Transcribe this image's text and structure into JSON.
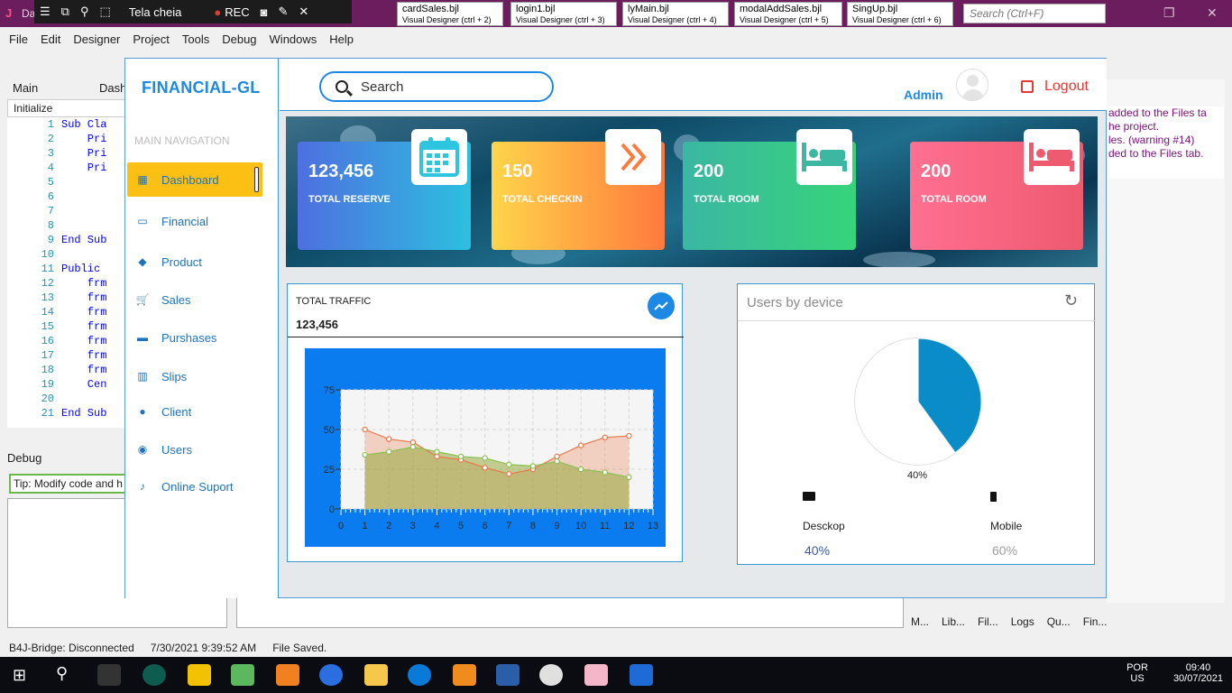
{
  "ide": {
    "recorder": {
      "label": "Tela cheia",
      "rec": "REC"
    },
    "doc_tabs": [
      {
        "name": "cardSales.bjl",
        "sub": "Visual Designer  (ctrl + 2)"
      },
      {
        "name": "login1.bjl",
        "sub": "Visual Designer  (ctrl + 3)"
      },
      {
        "name": "lyMain.bjl",
        "sub": "Visual Designer  (ctrl + 4)"
      },
      {
        "name": "modalAddSales.bjl",
        "sub": "Visual Designer  (ctrl + 5)"
      },
      {
        "name": "SingUp.bjl",
        "sub": "Visual Designer  (ctrl + 6)"
      }
    ],
    "search_placeholder": "Search (Ctrl+F)",
    "menu": [
      "File",
      "Edit",
      "Designer",
      "Project",
      "Tools",
      "Debug",
      "Windows",
      "Help"
    ],
    "tabs": [
      "Main",
      "Dash"
    ],
    "initialize": "Initialize",
    "code_lines": [
      {
        "n": "1",
        "t": "Sub Cla"
      },
      {
        "n": "2",
        "t": "    Pri"
      },
      {
        "n": "3",
        "t": "    Pri"
      },
      {
        "n": "4",
        "t": "    Pri"
      },
      {
        "n": "5",
        "t": ""
      },
      {
        "n": "6",
        "t": ""
      },
      {
        "n": "7",
        "t": ""
      },
      {
        "n": "8",
        "t": ""
      },
      {
        "n": "9",
        "t": "End Sub"
      },
      {
        "n": "10",
        "t": ""
      },
      {
        "n": "11",
        "t": "Public"
      },
      {
        "n": "12",
        "t": "    frm"
      },
      {
        "n": "13",
        "t": "    frm"
      },
      {
        "n": "14",
        "t": "    frm"
      },
      {
        "n": "15",
        "t": "    frm"
      },
      {
        "n": "16",
        "t": "    frm"
      },
      {
        "n": "17",
        "t": "    frm"
      },
      {
        "n": "18",
        "t": "    frm"
      },
      {
        "n": "19",
        "t": "    Cen"
      },
      {
        "n": "20",
        "t": ""
      },
      {
        "n": "21",
        "t": "End Sub"
      }
    ],
    "debug_label": "Debug",
    "tip": "Tip: Modify code and h",
    "right_msgs": [
      "added to the Files ta",
      "he project.",
      "les. (warning #14)",
      "ded to the Files tab."
    ],
    "right_tabs": [
      "M...",
      "Lib...",
      "Fil...",
      "Logs",
      "Qu...",
      "Fin..."
    ],
    "status": {
      "bridge": "B4J-Bridge: Disconnected",
      "time": "7/30/2021 9:39:52 AM",
      "msg": "File Saved."
    },
    "tray": {
      "lang": "POR",
      "region": "US",
      "clock": "09:40",
      "date": "30/07/2021"
    }
  },
  "app": {
    "brand": "FINANCIAL-GL",
    "nav_heading": "MAIN NAVIGATION",
    "nav": [
      {
        "label": "Dashboard",
        "icon": "grid-icon"
      },
      {
        "label": "Financial",
        "icon": "money-icon"
      },
      {
        "label": "Product",
        "icon": "cubes-icon"
      },
      {
        "label": "Sales",
        "icon": "cart-icon"
      },
      {
        "label": "Purshases",
        "icon": "truck-icon"
      },
      {
        "label": "Slips",
        "icon": "barcode-icon"
      },
      {
        "label": "Client",
        "icon": "users-icon"
      },
      {
        "label": "Users",
        "icon": "user-circle-icon"
      },
      {
        "label": "Online Suport",
        "icon": "assistive-listening-icon"
      }
    ],
    "search_placeholder": "Search",
    "admin": "Admin",
    "logout": "Logout",
    "cards": [
      {
        "value": "123,456",
        "label": "TOTAL RESERVE",
        "icon": "calendar-icon"
      },
      {
        "value": "150",
        "label": "TOTAL CHECKIN",
        "icon": "double-chevron-right-icon"
      },
      {
        "value": "200",
        "label": "TOTAL ROOM",
        "icon": "bed-icon"
      },
      {
        "value": "200",
        "label": "TOTAL ROOM",
        "icon": "bed-icon"
      }
    ],
    "traffic": {
      "title": "TOTAL TRAFFIC",
      "value": "123,456"
    },
    "devices": {
      "title": "Users by device",
      "pie_label": "40%",
      "items": [
        {
          "name": "Desckop",
          "pct": "40%",
          "icon": "monitor-icon",
          "color": "#3a5aa8"
        },
        {
          "name": "Mobile",
          "pct": "60%",
          "icon": "mobile-icon",
          "color": "#9e9e9e"
        }
      ]
    }
  },
  "chart_data": [
    {
      "type": "area",
      "x": [
        1,
        2,
        3,
        4,
        5,
        6,
        7,
        8,
        9,
        10,
        11,
        12
      ],
      "series": [
        {
          "values": [
            50,
            44,
            42,
            33,
            31,
            26,
            22,
            25,
            33,
            40,
            45,
            46
          ],
          "color": "#e8784a"
        },
        {
          "values": [
            34,
            36,
            39,
            36,
            33,
            32,
            28,
            27,
            30,
            25,
            23,
            20
          ],
          "color": "#8cc152"
        }
      ],
      "xlim": [
        0,
        13
      ],
      "ylim": [
        0,
        75
      ],
      "yticks": [
        0,
        25,
        50,
        75
      ],
      "xticks": [
        0,
        1,
        2,
        3,
        4,
        5,
        6,
        7,
        8,
        9,
        10,
        11,
        12,
        13
      ],
      "grid": true
    },
    {
      "type": "pie",
      "labels": [
        "Desckop",
        "Mobile"
      ],
      "values": [
        40,
        60
      ],
      "colors": [
        "#0a8cc8",
        "#ffffff"
      ]
    }
  ]
}
